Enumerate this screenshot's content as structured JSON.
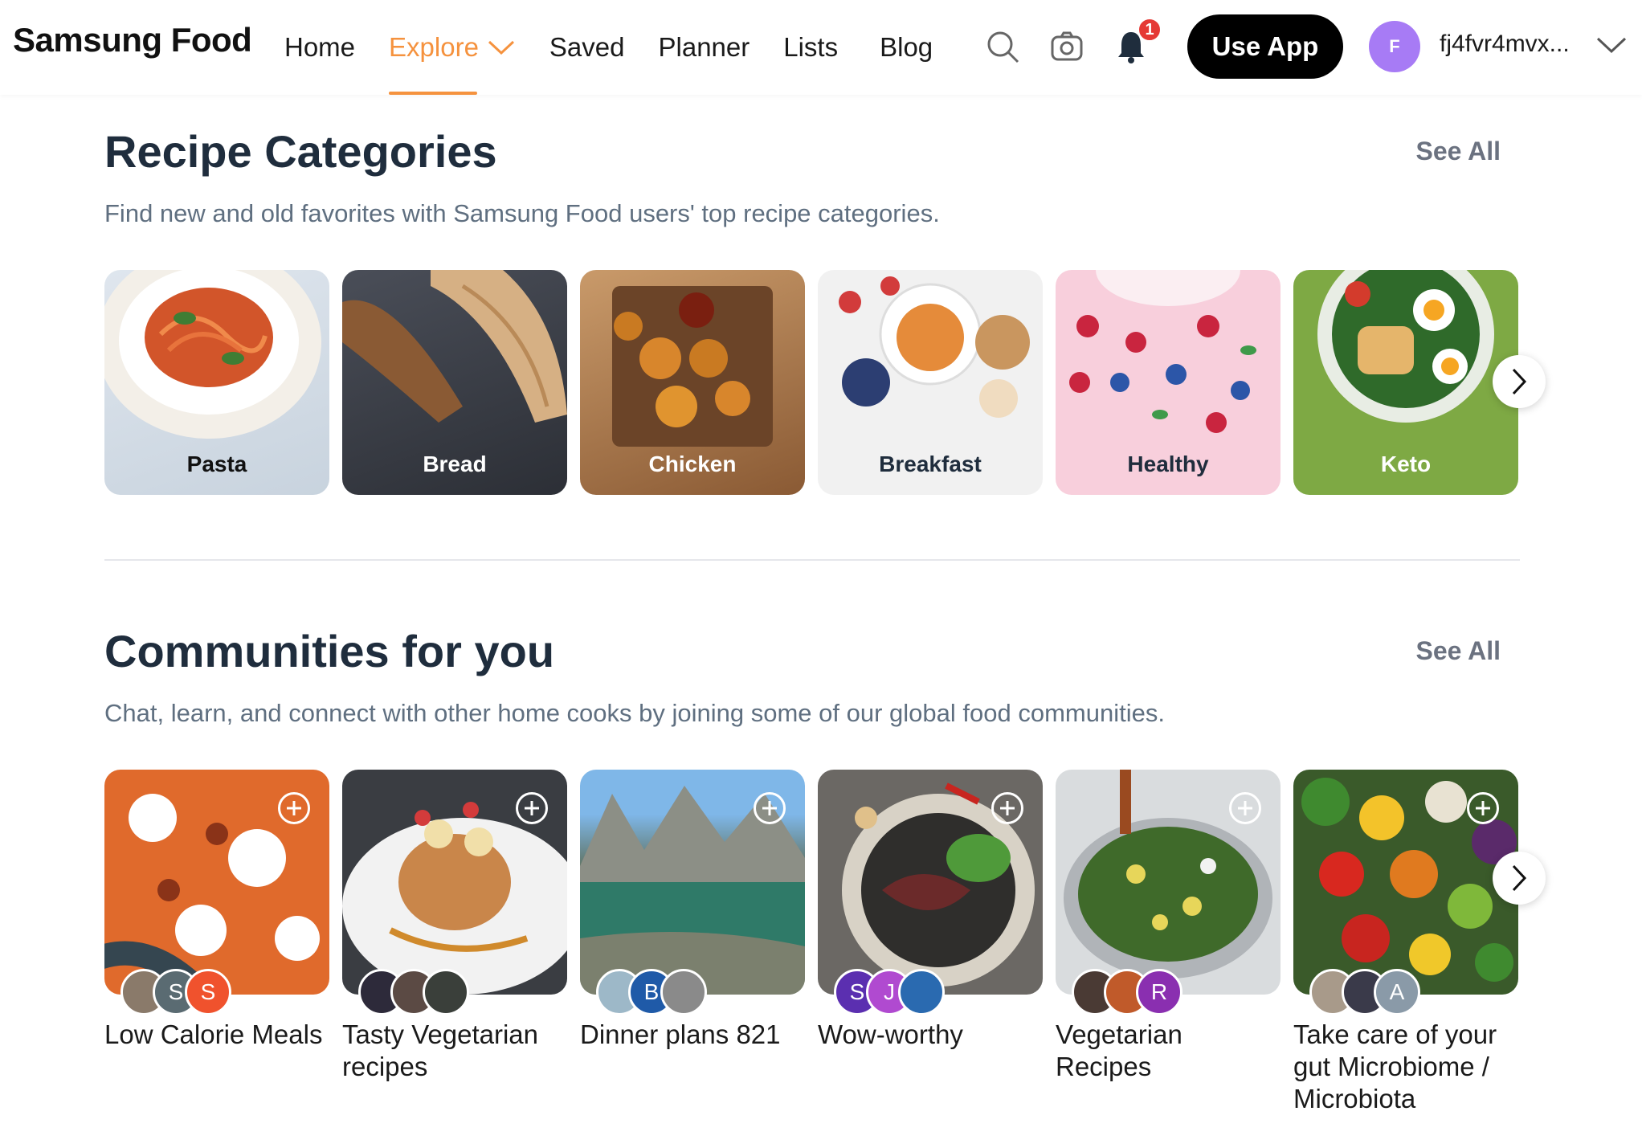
{
  "header": {
    "logo": "Samsung Food",
    "nav": [
      "Home",
      "Explore",
      "Saved",
      "Planner",
      "Lists",
      "Blog"
    ],
    "active_nav": "Explore",
    "notification_count": "1",
    "use_app_label": "Use App",
    "user_initial": "F",
    "username": "fj4fvr4mvx...",
    "icons": [
      "search-icon",
      "camera-icon",
      "bell-icon",
      "chevron-down-icon"
    ]
  },
  "categories": {
    "title": "Recipe Categories",
    "see_all": "See All",
    "subtitle": "Find new and old favorites with Samsung Food users' top recipe categories.",
    "items": [
      {
        "label": "Pasta"
      },
      {
        "label": "Bread"
      },
      {
        "label": "Chicken"
      },
      {
        "label": "Breakfast"
      },
      {
        "label": "Healthy"
      },
      {
        "label": "Keto"
      }
    ]
  },
  "communities": {
    "title": "Communities for you",
    "see_all": "See All",
    "subtitle": "Chat, learn, and connect with other home cooks by joining some of our global food communities.",
    "items": [
      {
        "name": "Low Calorie Meals",
        "members": [
          "",
          "S",
          "S"
        ]
      },
      {
        "name": "Tasty Vegetarian recipes",
        "members": [
          "",
          "",
          ""
        ]
      },
      {
        "name": "Dinner plans 821",
        "members": [
          "",
          "B",
          ""
        ]
      },
      {
        "name": "Wow-worthy",
        "members": [
          "S",
          "J",
          ""
        ]
      },
      {
        "name": "Vegetarian Recipes",
        "members": [
          "",
          "",
          "R"
        ]
      },
      {
        "name": "Take care of your gut Microbiome / Microbiota",
        "members": [
          "",
          "",
          "A"
        ]
      }
    ]
  },
  "colors": {
    "accent": "#f5923e",
    "notification": "#e53935",
    "avatar": "#a77bf5"
  }
}
